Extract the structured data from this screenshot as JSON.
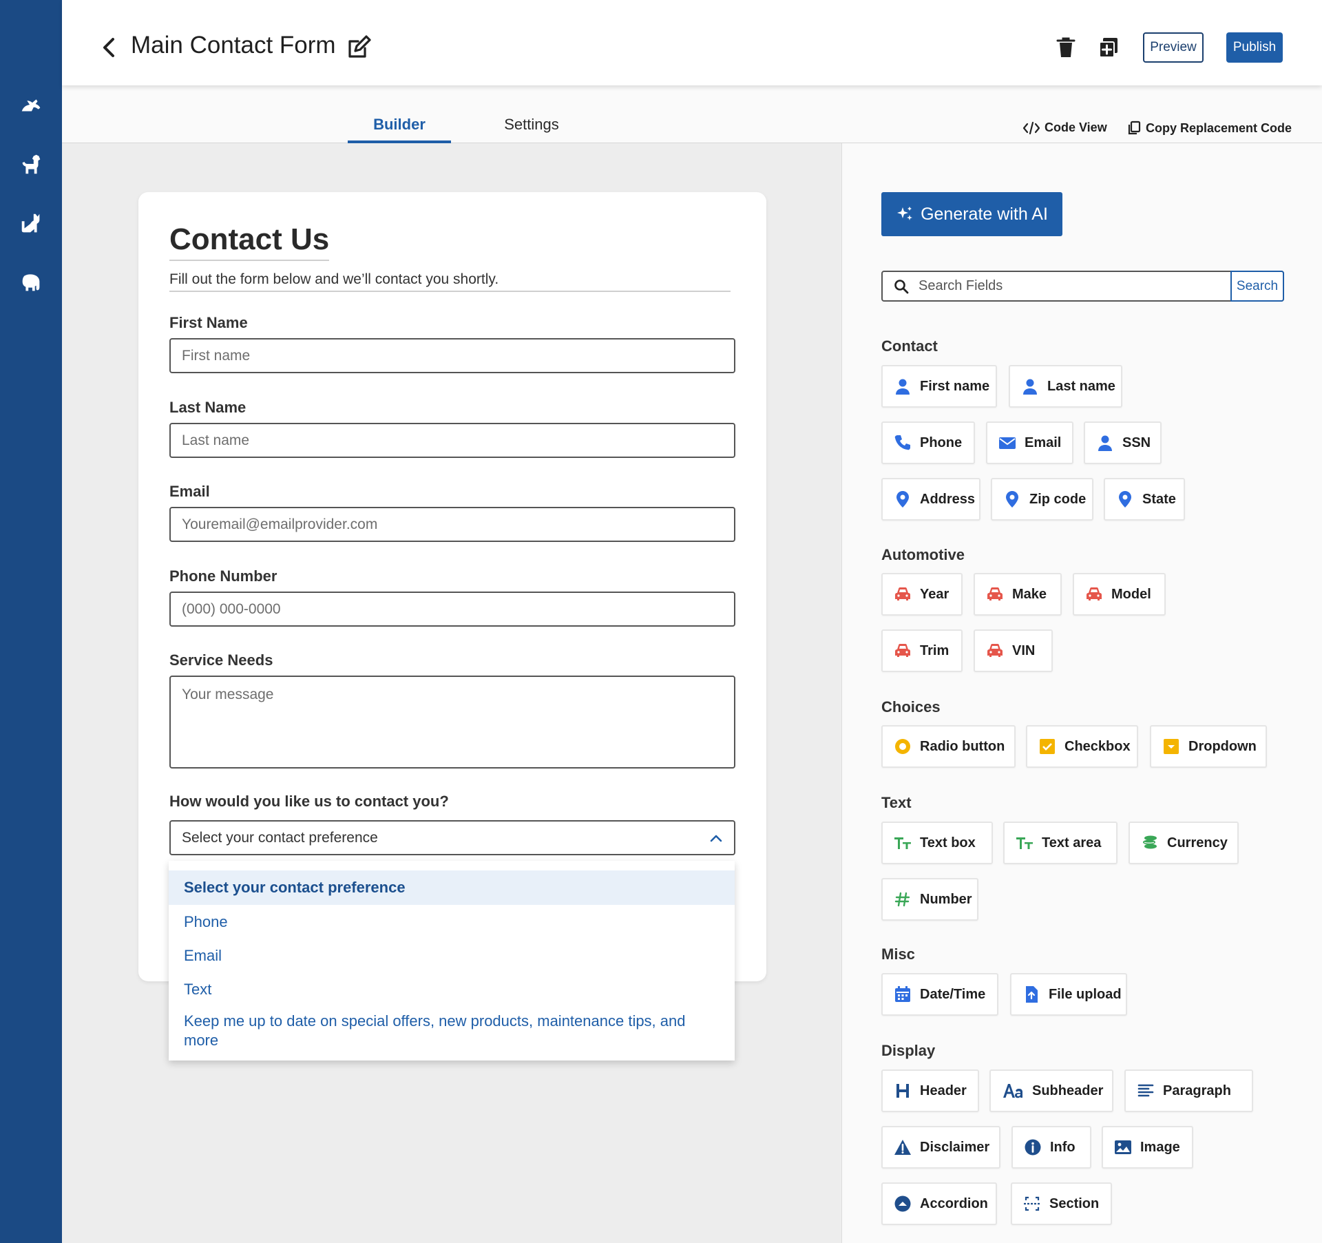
{
  "header": {
    "title": "Main Contact Form",
    "preview_label": "Preview",
    "publish_label": "Publish"
  },
  "tabs": {
    "builder": "Builder",
    "settings": "Settings",
    "code_view": "Code View",
    "copy_code": "Copy Replacement Code"
  },
  "form": {
    "title": "Contact Us",
    "subtitle": "Fill out the form below and we’ll contact you shortly.",
    "fields": {
      "first_name": {
        "label": "First Name",
        "placeholder": "First name"
      },
      "last_name": {
        "label": "Last Name",
        "placeholder": "Last name"
      },
      "email": {
        "label": "Email",
        "placeholder": "Youremail@emailprovider.com"
      },
      "phone": {
        "label": "Phone Number",
        "placeholder": "(000) 000-0000"
      },
      "service": {
        "label": "Service Needs",
        "placeholder": "Your message"
      },
      "contact_pref": {
        "label": "How would you like us to contact you?",
        "value": "Select your contact preference"
      }
    },
    "dropdown_options": [
      "Select your contact preference",
      "Phone",
      "Email",
      "Text",
      "Keep me up to date on special offers, new products, maintenance tips, and more"
    ]
  },
  "panel": {
    "generate_label": "Generate with AI",
    "search_placeholder": "Search Fields",
    "search_button": "Search",
    "groups": {
      "contact": "Contact",
      "automotive": "Automotive",
      "choices": "Choices",
      "text": "Text",
      "misc": "Misc",
      "display": "Display"
    },
    "chips": {
      "first_name": "First name",
      "last_name": "Last name",
      "phone": "Phone",
      "email": "Email",
      "ssn": "SSN",
      "address": "Address",
      "zip": "Zip code",
      "state": "State",
      "year": "Year",
      "make": "Make",
      "model": "Model",
      "trim": "Trim",
      "vin": "VIN",
      "radio": "Radio button",
      "checkbox": "Checkbox",
      "dropdown": "Dropdown",
      "textbox": "Text box",
      "textarea": "Text area",
      "currency": "Currency",
      "number": "Number",
      "datetime": "Date/Time",
      "fileupload": "File upload",
      "header": "Header",
      "subheader": "Subheader",
      "paragraph": "Paragraph",
      "disclaimer": "Disclaimer",
      "info": "Info",
      "image": "Image",
      "accordion": "Accordion",
      "section": "Section"
    }
  },
  "colors": {
    "rail": "#1b4a84",
    "accent": "#1f5ea8",
    "contact_icon": "#2f6de0",
    "automotive_icon": "#e5564b",
    "choice_icon": "#f4b400",
    "text_icon": "#3aa757"
  }
}
